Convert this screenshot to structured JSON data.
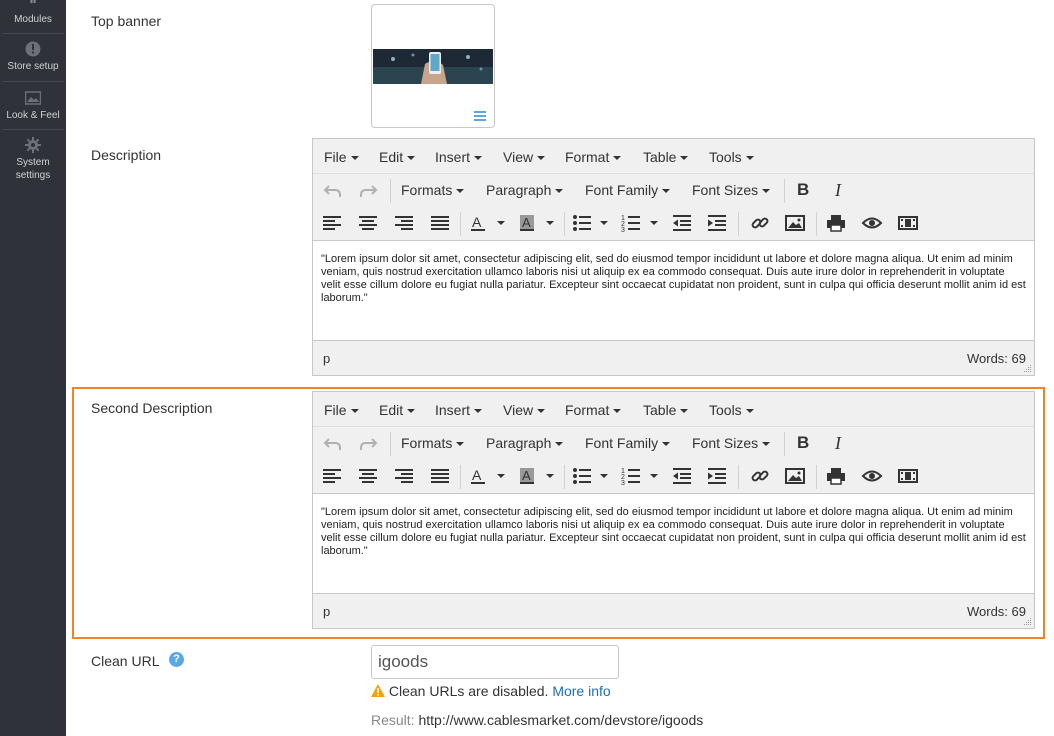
{
  "sidebar": {
    "items": [
      {
        "label": "Modules",
        "icon": "modules-icon"
      },
      {
        "label": "Store setup",
        "icon": "store-setup-icon"
      },
      {
        "label": "Look & Feel",
        "icon": "look-feel-icon"
      },
      {
        "label": "System settings",
        "icon": "system-settings-icon"
      }
    ]
  },
  "fields": {
    "top_banner_label": "Top banner",
    "description_label": "Description",
    "second_description_label": "Second Description",
    "clean_url_label": "Clean URL"
  },
  "editor": {
    "menu": [
      "File",
      "Edit",
      "Insert",
      "View",
      "Format",
      "Table",
      "Tools"
    ],
    "dropdowns": [
      "Formats",
      "Paragraph",
      "Font Family",
      "Font Sizes"
    ],
    "bold": "B",
    "italic": "I",
    "content": "\"Lorem ipsum dolor sit amet, consectetur adipiscing elit, sed do eiusmod tempor incididunt ut labore et dolore magna aliqua. Ut enim ad minim veniam, quis nostrud exercitation ullamco laboris nisi ut aliquip ex ea commodo consequat. Duis aute irure dolor in reprehenderit in voluptate velit esse cillum dolore eu fugiat nulla pariatur. Excepteur sint occaecat cupidatat non proident, sunt in culpa qui officia deserunt mollit anim id est laborum.\"",
    "path": "p",
    "word_count": "Words: 69"
  },
  "clean_url": {
    "value": "igoods",
    "help": "?",
    "warning": "Clean URLs are disabled.",
    "more_info": "More info",
    "result_label": "Result:",
    "result_url": "http://www.cablesmarket.com/devstore/igoods"
  },
  "colors": {
    "sidebar_bg": "#2f3238",
    "highlight": "#f0822a",
    "link": "#1a6fb5",
    "help_icon": "#5aa9e6",
    "warning_icon": "#f0a30a"
  }
}
